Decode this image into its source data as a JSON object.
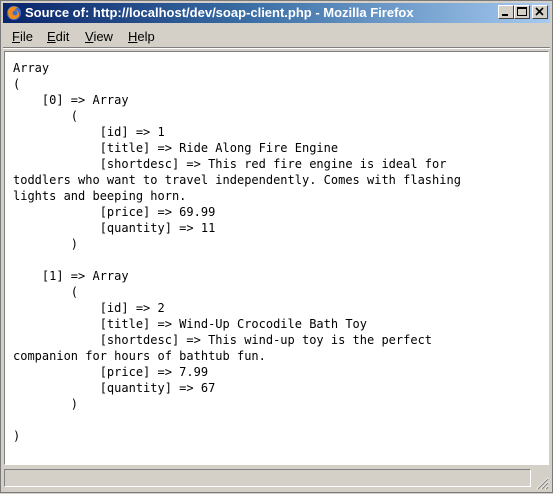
{
  "window": {
    "title": "Source of: http://localhost/dev/soap-client.php - Mozilla Firefox",
    "app_icon": "firefox-icon",
    "controls": [
      "minimize-icon",
      "maximize-icon",
      "close-icon"
    ]
  },
  "menu": {
    "file": {
      "accel": "F",
      "rest": "ile"
    },
    "edit": {
      "accel": "E",
      "rest": "dit"
    },
    "view": {
      "accel": "V",
      "rest": "iew"
    },
    "help": {
      "accel": "H",
      "rest": "elp"
    }
  },
  "source": {
    "lines": [
      "Array",
      "(",
      "    [0] => Array",
      "        (",
      "            [id] => 1",
      "            [title] => Ride Along Fire Engine",
      "            [shortdesc] => This red fire engine is ideal for",
      "toddlers who want to travel independently. Comes with flashing",
      "lights and beeping horn.",
      "            [price] => 69.99",
      "            [quantity] => 11",
      "        )",
      "",
      "    [1] => Array",
      "        (",
      "            [id] => 2",
      "            [title] => Wind-Up Crocodile Bath Toy",
      "            [shortdesc] => This wind-up toy is the perfect",
      "companion for hours of bathtub fun.",
      "            [price] => 7.99",
      "            [quantity] => 67",
      "        )",
      "",
      ")"
    ]
  },
  "statusbar": {
    "text": ""
  }
}
